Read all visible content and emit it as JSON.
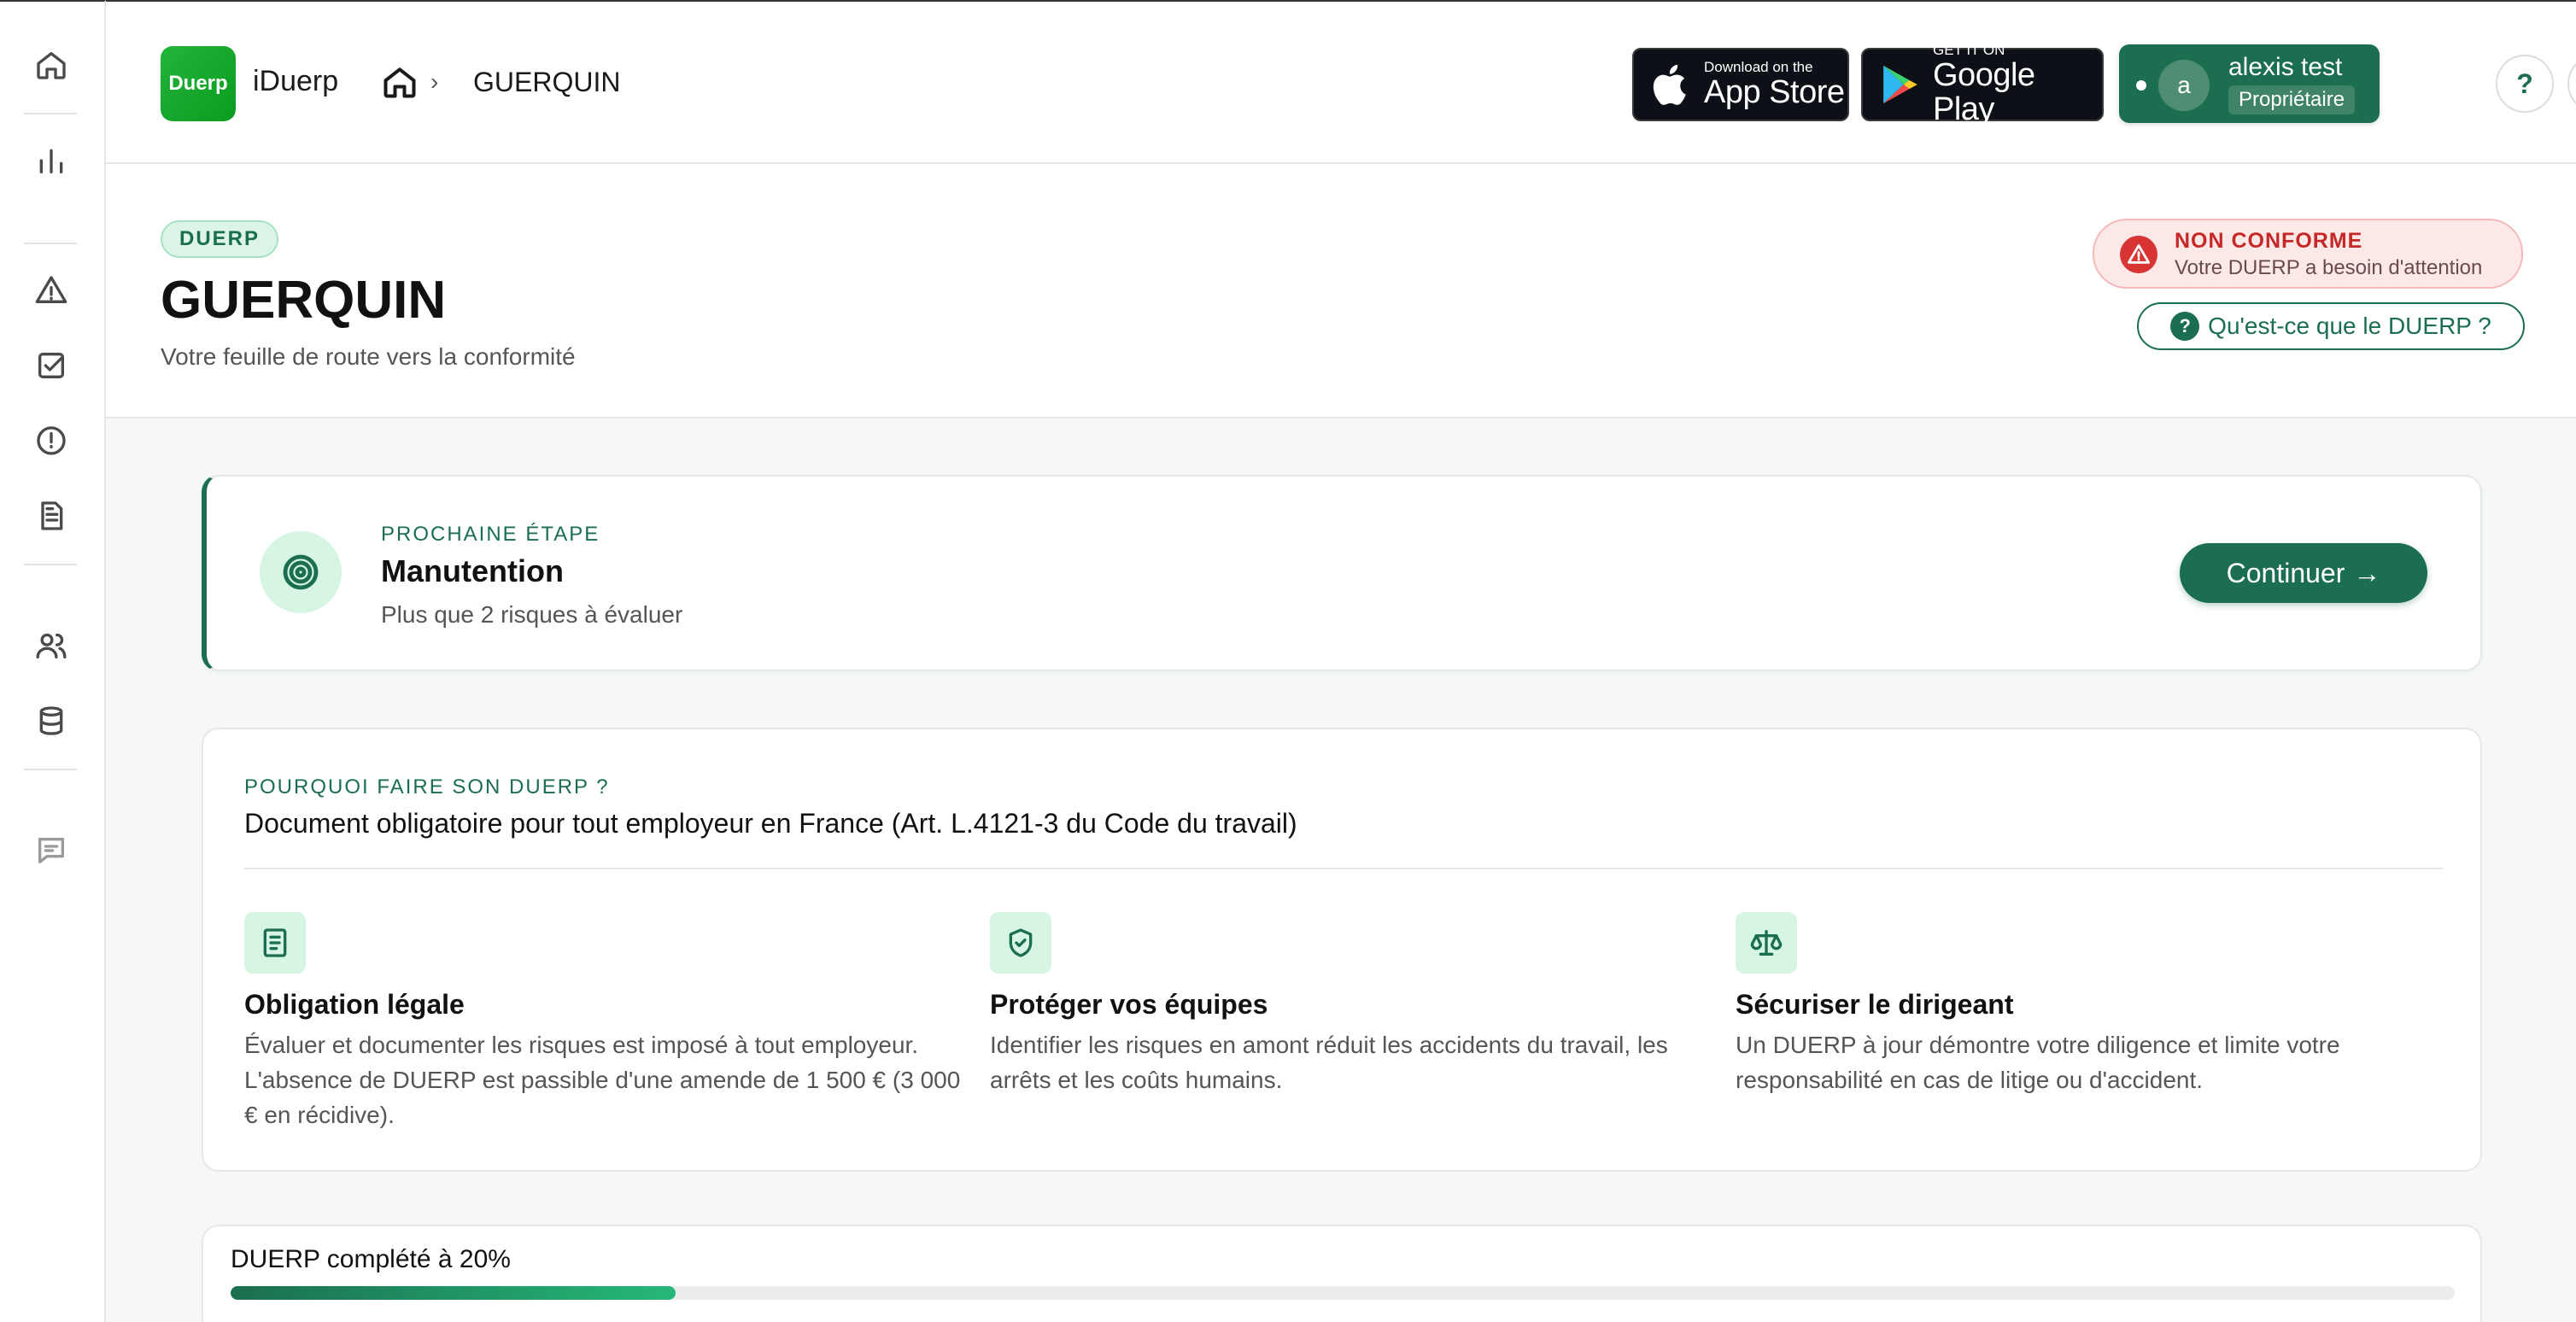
{
  "app": {
    "logo_text": "Duerp",
    "name": "iDuerp"
  },
  "breadcrumb": {
    "current": "GUERQUIN",
    "separator": "›"
  },
  "stores": {
    "apple_small": "Download on the",
    "apple_big": "App Store",
    "google_small": "GET IT ON",
    "google_big": "Google Play"
  },
  "user": {
    "initial": "a",
    "name": "alexis test",
    "role": "Propriétaire"
  },
  "header_buttons": {
    "help_label": "?"
  },
  "page": {
    "tag": "DUERP",
    "title": "GUERQUIN",
    "subtitle": "Votre feuille de route vers la conformité"
  },
  "status": {
    "label": "NON CONFORME",
    "message": "Votre DUERP a besoin d'attention",
    "color": "#c62828"
  },
  "whatis": {
    "icon": "?",
    "label": "Qu'est-ce que le DUERP ?"
  },
  "next_step": {
    "label": "PROCHAINE ÉTAPE",
    "title": "Manutention",
    "description": "Plus que 2 risques à évaluer",
    "button": "Continuer",
    "button_arrow": "→"
  },
  "why": {
    "label": "POURQUOI FAIRE SON DUERP ?",
    "title": "Document obligatoire pour tout employeur en France (Art. L.4121-3 du Code du travail)",
    "benefits": [
      {
        "icon": "document-icon",
        "title": "Obligation légale",
        "description": "Évaluer et documenter les risques est imposé à tout employeur. L'absence de DUERP est passible d'une amende de 1 500 € (3 000 € en récidive)."
      },
      {
        "icon": "shield-check-icon",
        "title": "Protéger vos équipes",
        "description": "Identifier les risques en amont réduit les accidents du travail, les arrêts et les coûts humains."
      },
      {
        "icon": "scale-icon",
        "title": "Sécuriser le dirigeant",
        "description": "Un DUERP à jour démontre votre diligence et limite votre responsabilité en cas de litige ou d'accident."
      }
    ]
  },
  "progress": {
    "label": "DUERP complété à 20%",
    "percent": 20
  },
  "colors": {
    "brand": "#1b6e4f",
    "logo": "#0a9b1f",
    "danger": "#d93434"
  }
}
